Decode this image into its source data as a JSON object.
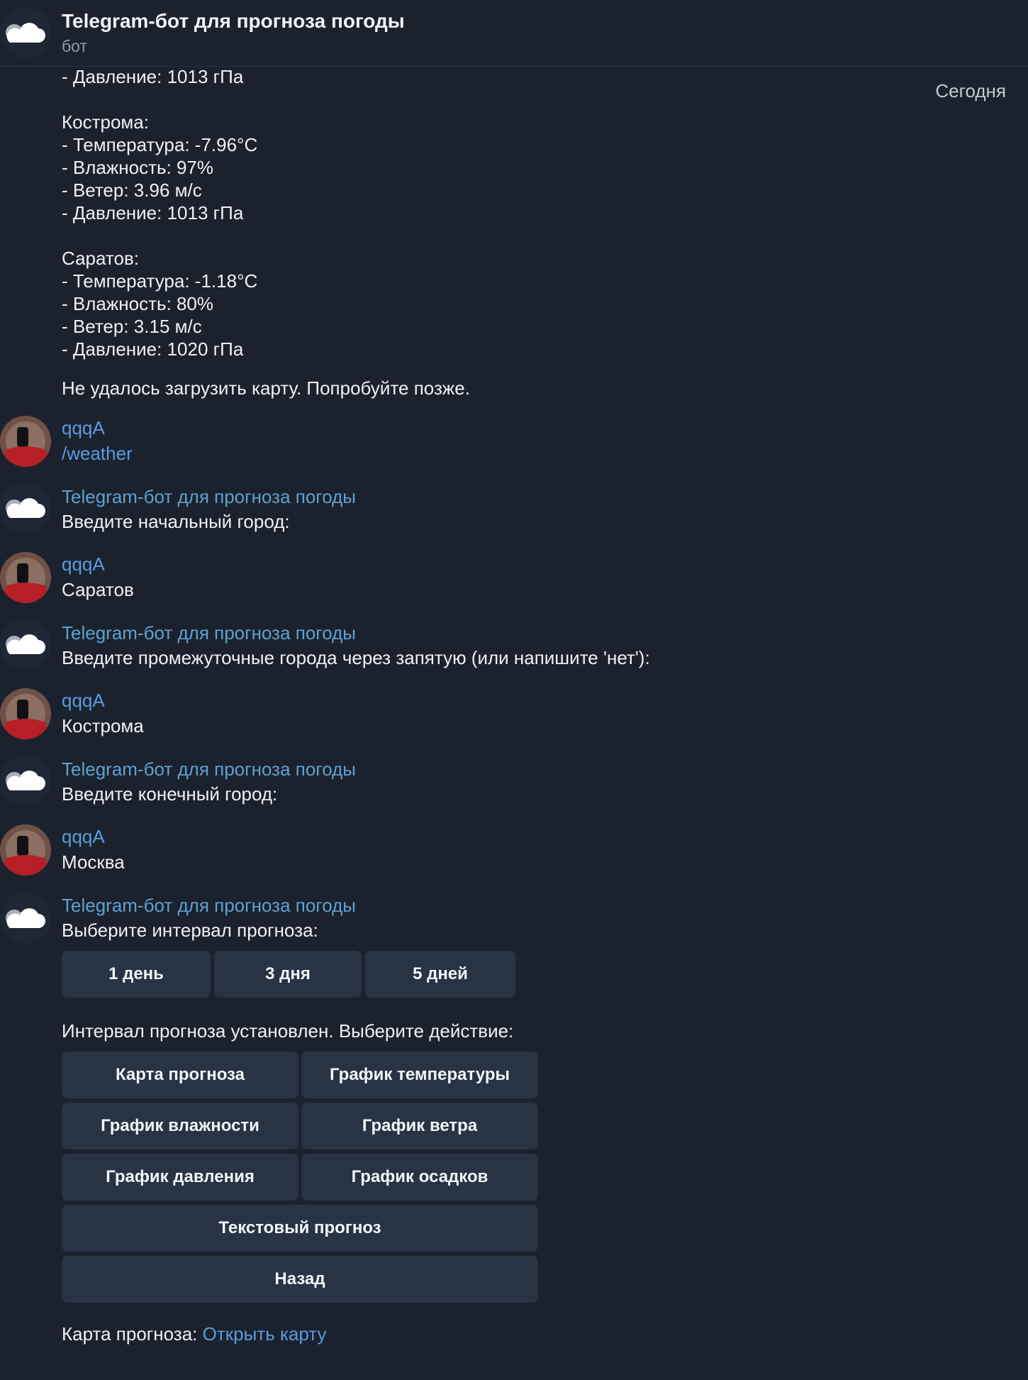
{
  "header": {
    "title": "Telegram-бот для прогноза погоды",
    "subtitle": "бот",
    "icon": "cloud-icon"
  },
  "date_label": "Сегодня",
  "previous_message": {
    "line_pressure_top": "- Давление: 1013 гПа",
    "kostroma_title": "Кострома:",
    "kostroma_temp": "- Температура: -7.96°C",
    "kostroma_humidity": "- Влажность: 97%",
    "kostroma_wind": "- Ветер: 3.96 м/с",
    "kostroma_pressure": "- Давление: 1013 гПа",
    "saratov_title": "Саратов:",
    "saratov_temp": "- Температура: -1.18°C",
    "saratov_humidity": "- Влажность: 80%",
    "saratov_wind": "- Ветер: 3.15 м/с",
    "saratov_pressure": "- Давление: 1020 гПа",
    "map_error": "Не удалось загрузить карту. Попробуйте позже."
  },
  "messages": [
    {
      "author": "qqqA",
      "text": "/weather"
    },
    {
      "author": "Telegram-бот для прогноза погоды",
      "text": "Введите начальный город:"
    },
    {
      "author": "qqqA",
      "text": "Саратов"
    },
    {
      "author": "Telegram-бот для прогноза погоды",
      "text": "Введите промежуточные города через запятую (или напишите 'нет'):"
    },
    {
      "author": "qqqA",
      "text": "Кострома"
    },
    {
      "author": "Telegram-бот для прогноза погоды",
      "text": "Введите конечный город:"
    },
    {
      "author": "qqqA",
      "text": "Москва"
    },
    {
      "author": "Telegram-бот для прогноза погоды",
      "text": "Выберите интервал прогноза:"
    }
  ],
  "interval_buttons": [
    "1 день",
    "3 дня",
    "5 дней"
  ],
  "action_prompt": "Интервал прогноза установлен. Выберите действие:",
  "action_buttons": {
    "forecast_map": "Карта прогноза",
    "temperature_chart": "График температуры",
    "humidity_chart": "График влажности",
    "wind_chart": "График ветра",
    "pressure_chart": "График давления",
    "precipitation_chart": "График осадков",
    "text_forecast": "Текстовый прогноз",
    "back": "Назад"
  },
  "final_message": {
    "prefix": "Карта прогноза: ",
    "link": "Открыть карту"
  },
  "colors": {
    "background": "#1b222d",
    "button": "#283343",
    "link": "#5b9be0",
    "bot_name": "#5ea1d1"
  }
}
